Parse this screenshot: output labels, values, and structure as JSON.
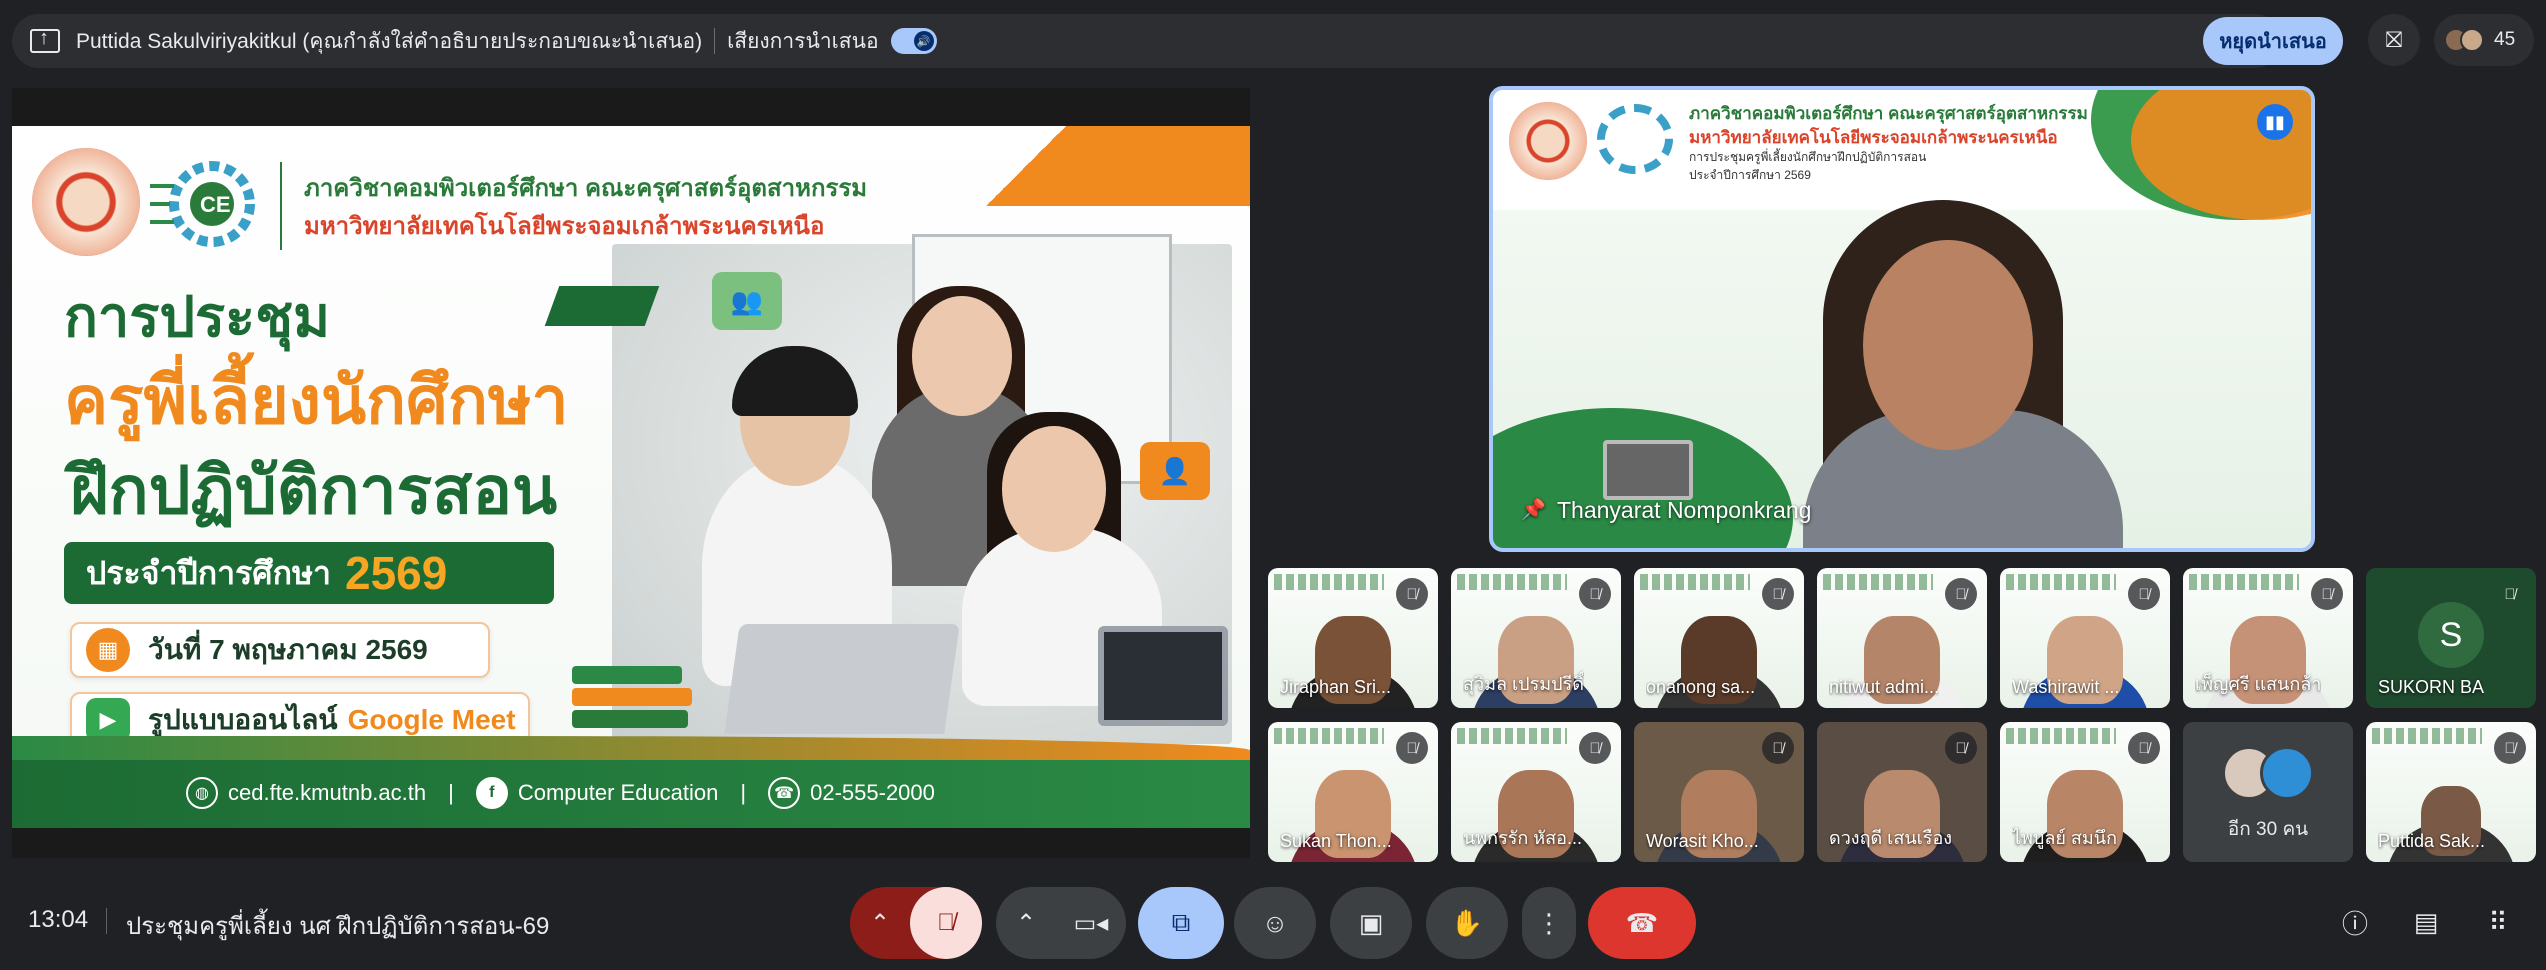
{
  "topbar": {
    "presenter_text": "Puttida Sakulviriyakitkul (คุณกำลังใส่คำอธิบายประกอบขณะนำเสนอ)",
    "audio_label": "เสียงการนำเสนอ",
    "stop_label": "หยุดนำเสนอ",
    "people_count": "45"
  },
  "slide": {
    "dept_line1": "ภาควิชาคอมพิวเตอร์ศึกษา คณะครุศาสตร์อุตสาหกรรม",
    "dept_line2": "มหาวิทยาลัยเทคโนโลยีพระจอมเกล้าพระนครเหนือ",
    "heading1": "การประชุม",
    "heading2": "ครูพี่เลี้ยงนักศึกษา",
    "heading3": "ฝึกปฏิบัติการสอน",
    "year_label": "ประจำปีการศึกษา",
    "year_value": "2569",
    "date_text": "วันที่ 7 พฤษภาคม 2569",
    "format_text": "รูปแบบออนไลน์",
    "format_accent": "Google Meet",
    "footer_web": "ced.fte.kmutnb.ac.th",
    "footer_sep": "|",
    "footer_fb": "Computer Education",
    "footer_phone": "02-555-2000"
  },
  "speaker": {
    "name": "Thanyarat Nomponkrang",
    "slide_line1": "ภาควิชาคอมพิวเตอร์ศึกษา คณะครุศาสตร์อุตสาหกรรม",
    "slide_line2": "มหาวิทยาลัยเทคโนโลยีพระจอมเกล้าพระนครเหนือ",
    "slide_line3": "การประชุมครูพี่เลี้ยงนักศึกษาฝึกปฏิบัติการสอน",
    "slide_line4": "ประจำปีการศึกษา 2569"
  },
  "participants": [
    {
      "name": "Jiraphan Sri..."
    },
    {
      "name": "สุวิมล เปรมปรีดิ์"
    },
    {
      "name": "onanong sa..."
    },
    {
      "name": "nitiwut admi..."
    },
    {
      "name": "Washirawit ..."
    },
    {
      "name": "เพ็ญศรี แสนกล้า"
    },
    {
      "name": "SUKORN BA",
      "initial": "S"
    },
    {
      "name": "Sukan Thon..."
    },
    {
      "name": "นพกรรัก หัสอ..."
    },
    {
      "name": "Worasit Kho..."
    },
    {
      "name": "ดวงฤดี เสนเรือง"
    },
    {
      "name": "ไพบูลย์ สมนึก"
    },
    {
      "name": "อีก 30 คน"
    },
    {
      "name": "Puttida Sak..."
    }
  ],
  "bottom": {
    "time": "13:04",
    "meeting_title": "ประชุมครูพี่เลี้ยง นศ ฝึกปฏิบัติการสอน-69"
  },
  "colors": {
    "accent": "#a8c7fa",
    "danger": "#ea4335",
    "slide_green": "#1c6b34",
    "slide_orange": "#f08a1e"
  }
}
